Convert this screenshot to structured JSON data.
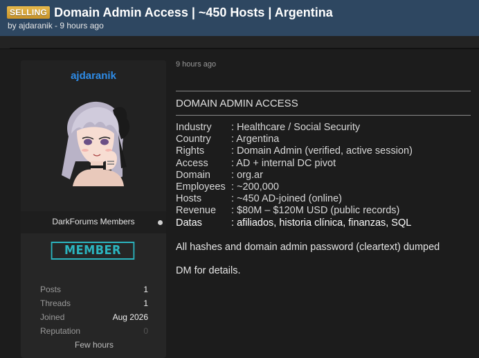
{
  "header": {
    "badge": "SELLING",
    "title": "Domain Admin Access | ~450 Hosts | Argentina",
    "byline": "by ajdaranik - 9 hours ago"
  },
  "sidebar": {
    "username": "ajdaranik",
    "group": "DarkForums Members",
    "rank": "MEMBER",
    "stats": [
      {
        "label": "Posts",
        "value": "1"
      },
      {
        "label": "Threads",
        "value": "1"
      },
      {
        "label": "Joined",
        "value": "Aug 2026"
      },
      {
        "label": "Reputation",
        "value": "0"
      }
    ],
    "extra": "Few hours",
    "colors": {
      "username": "#2e8ce8",
      "rank": "#2bb5c0"
    }
  },
  "post": {
    "time": "9 hours ago",
    "heading": "DOMAIN ADMIN ACCESS",
    "fields": [
      {
        "label": "Industry",
        "value": "Healthcare / Social Security"
      },
      {
        "label": "Country",
        "value": "Argentina"
      },
      {
        "label": "Rights",
        "value": "Domain Admin (verified, active session)"
      },
      {
        "label": "Access",
        "value": "AD + internal DC pivot"
      },
      {
        "label": "Domain",
        "value": "org.ar"
      },
      {
        "label": "Employees",
        "value": "~200,000"
      },
      {
        "label": "Hosts",
        "value": "~450 AD-joined (online)"
      },
      {
        "label": "Revenue",
        "value": "$80M – $120M USD (public records)"
      },
      {
        "label": "Datas",
        "value": "afiliados, historia clínica, finanzas, SQL"
      }
    ],
    "paragraph1": "All hashes and domain admin password (cleartext) dumped",
    "paragraph2": "DM for details."
  }
}
